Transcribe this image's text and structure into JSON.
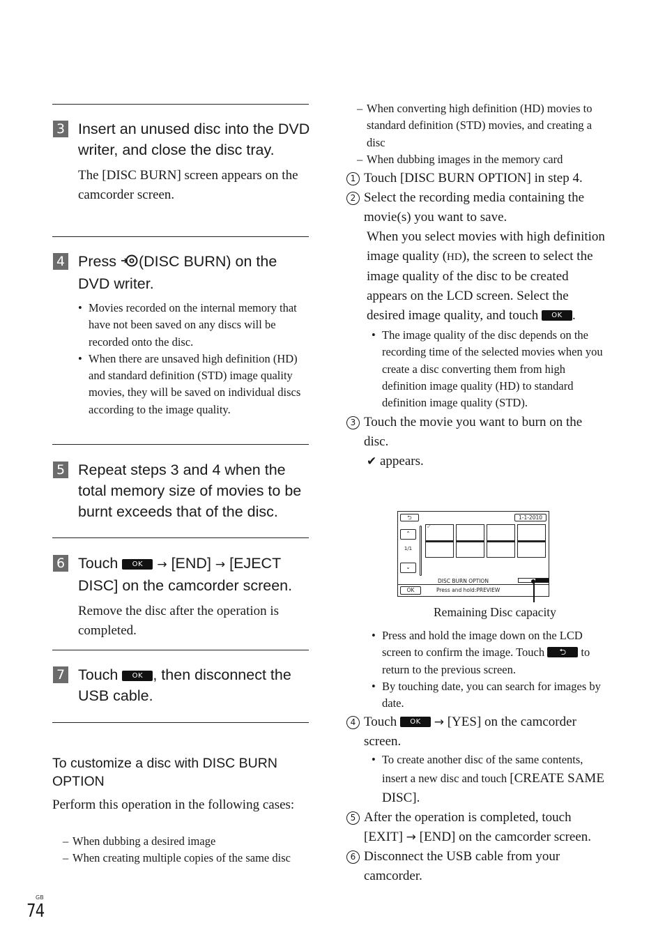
{
  "left": {
    "steps": [
      {
        "num": "3",
        "title": "Insert an unused disc into the DVD writer, and close the disc tray.",
        "body": "The [DISC BURN] screen appears on the camcorder screen."
      },
      {
        "num": "4",
        "title_prefix": "Press",
        "icon": "disc-burn-icon",
        "title_suffix": "(DISC BURN) on the DVD writer.",
        "bullets": [
          "Movies recorded on the internal memory that have not been saved on any discs will be recorded onto the disc.",
          "When there are unsaved high definition (HD) and standard definition (STD) image quality movies, they will be saved on individual discs according to the image quality."
        ]
      },
      {
        "num": "5",
        "title": "Repeat steps 3 and 4 when the total memory size of movies to be burnt exceeds that of the disc."
      },
      {
        "num": "6",
        "title_prefix": "Touch",
        "ok_label": "OK",
        "arrow": "→",
        "title_mid": "[END]",
        "title_suffix": "[EJECT DISC] on the camcorder screen.",
        "body": "Remove the disc after the operation is completed."
      },
      {
        "num": "7",
        "title_prefix": "Touch",
        "ok_label": "OK",
        "title_suffix": ", then disconnect the USB cable."
      }
    ],
    "customize": {
      "heading": "To customize a disc with DISC BURN OPTION",
      "intro": "Perform this operation in the following cases:",
      "cases": [
        "When dubbing a desired image",
        "When creating multiple copies of the same disc"
      ]
    }
  },
  "right": {
    "cases_continued": [
      "When converting high definition (HD) movies to standard definition (STD) movies, and creating a disc",
      "When dubbing images in the memory card"
    ],
    "substeps": [
      {
        "num": "1",
        "text": "Touch [DISC BURN OPTION] in step 4."
      },
      {
        "num": "2",
        "text": "Select the recording media containing the movie(s) you want to save.",
        "detail_a": "When you select movies with high definition image quality (",
        "hd": "HD",
        "detail_b": "), the screen to select the image quality of the disc to be created appears on the LCD screen. Select the desired image quality, and touch",
        "ok_label": "OK",
        "detail_end": ".",
        "bullets": [
          "The image quality of the disc depends on the recording time of the selected movies when you create a disc converting them from high definition image quality (HD) to standard definition image quality (STD)."
        ]
      },
      {
        "num": "3",
        "text": "Touch the movie you want to burn on the disc.",
        "check": "✔",
        "check_text": "appears.",
        "bullet1_a": "Press and hold the image down on the LCD screen to confirm the image. Touch",
        "back_icon": "⮌",
        "bullet1_b": "to return to the previous screen.",
        "bullet2": "By touching date, you can search for images by date."
      },
      {
        "num": "4",
        "prefix": "Touch",
        "ok_label": "OK",
        "arrow": "→",
        "suffix": "[YES] on the camcorder screen.",
        "bullet_a": "To create another disc of the same contents, insert a new disc and touch",
        "bullet_b": "[CREATE SAME DISC]."
      },
      {
        "num": "5",
        "text_a": "After the operation is completed, touch [EXIT]",
        "arrow": "→",
        "text_b": "[END] on the camcorder screen."
      },
      {
        "num": "6",
        "text": "Disconnect the USB cable from your camcorder."
      }
    ],
    "lcd": {
      "back": "⮌",
      "date": "1-1-2010",
      "up": "⌃",
      "page": "1/1",
      "down": "⌄",
      "check": "✓",
      "option_label": "DISC BURN OPTION",
      "ok": "OK",
      "hint": "Press and hold:PREVIEW",
      "remaining_capacity_used_fraction": 0.45,
      "caption": "Remaining Disc capacity"
    }
  },
  "footer": {
    "lang": "GB",
    "page": "74"
  }
}
